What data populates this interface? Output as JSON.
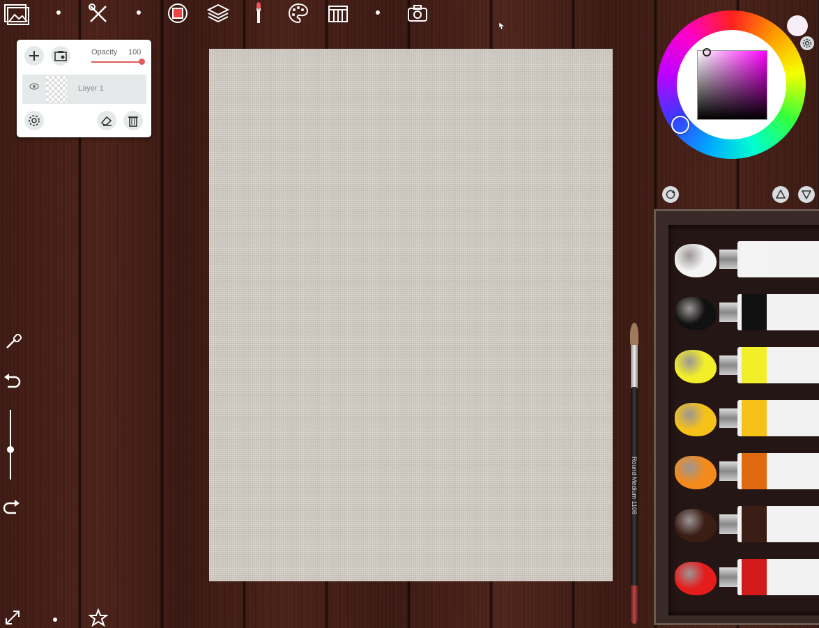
{
  "toolbar": {
    "icons": [
      "gallery-icon",
      "tools-icon",
      "canvas-icon",
      "layers-icon",
      "brush-icon",
      "palette-icon",
      "reference-icon",
      "camera-icon"
    ]
  },
  "layers_panel": {
    "opacity_label": "Opacity",
    "opacity_value": "100",
    "opacity_fraction": 1.0,
    "layer_name": "Layer 1"
  },
  "color": {
    "current": "#ff00ff",
    "swatch": "#f8eef8"
  },
  "brush": {
    "label": "Round Medium 1108"
  },
  "paint_tubes": [
    {
      "name": "titanium-white",
      "color": "#f4f4f4",
      "band": "#f4f4f4"
    },
    {
      "name": "titanium-black",
      "color": "#111111",
      "band": "#111111"
    },
    {
      "name": "cadmium-yellow-light",
      "color": "#f2ef2a",
      "band": "#f2ef2a"
    },
    {
      "name": "cadmium-yellow-medium",
      "color": "#f6c21a",
      "band": "#f6c21a"
    },
    {
      "name": "cadmium-orange",
      "color": "#f38a1c",
      "band": "#e06a10"
    },
    {
      "name": "burnt-umber",
      "color": "#3a1d14",
      "band": "#3a1d14"
    },
    {
      "name": "cadmium-red",
      "color": "#e51c1c",
      "band": "#d11a1a"
    }
  ]
}
